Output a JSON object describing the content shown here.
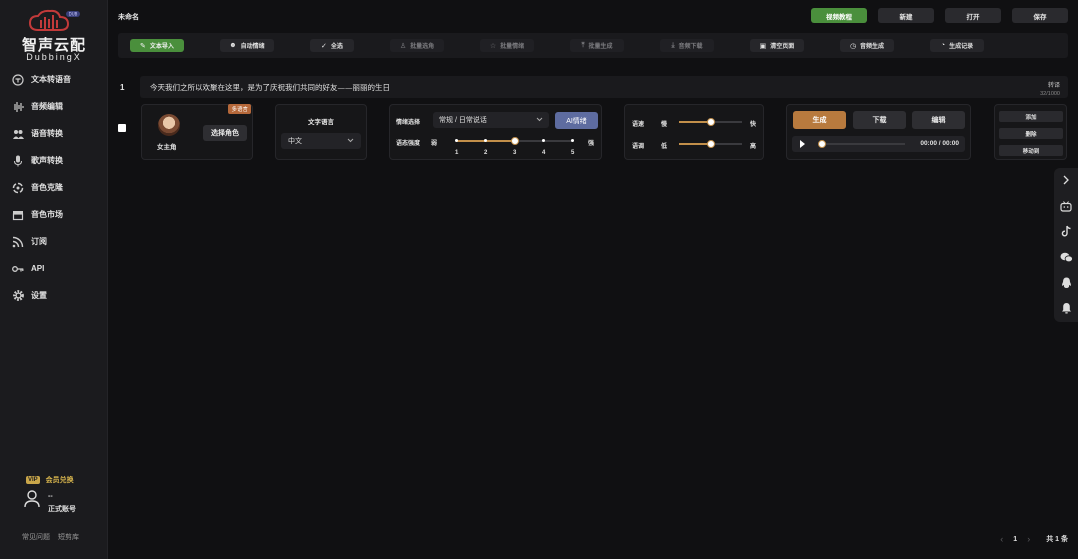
{
  "brand": {
    "name": "智声云配",
    "sub": "DubbingX",
    "badge": "DUB"
  },
  "nav": [
    {
      "label": "文本转语音",
      "icon": "text-to-speech-icon"
    },
    {
      "label": "音频编辑",
      "icon": "waveform-icon"
    },
    {
      "label": "语音转换",
      "icon": "voice-convert-icon"
    },
    {
      "label": "歌声转换",
      "icon": "microphone-icon"
    },
    {
      "label": "音色克隆",
      "icon": "clone-icon"
    },
    {
      "label": "音色市场",
      "icon": "store-icon"
    },
    {
      "label": "订阅",
      "icon": "rss-icon"
    },
    {
      "label": "API",
      "icon": "key-icon"
    },
    {
      "label": "设置",
      "icon": "gear-icon"
    }
  ],
  "sidebar_bottom": {
    "vip_badge": "VIP",
    "vip_label": "会员兑换",
    "user_name": "--",
    "account_type": "正式账号",
    "faq": "常见问题",
    "shortcuts": "短剪库"
  },
  "header": {
    "project_name": "未命名",
    "buttons": {
      "tutorial": "视频教程",
      "new": "新建",
      "open": "打开",
      "save": "保存"
    }
  },
  "toolbar": [
    {
      "label": "文本导入",
      "icon": "✎",
      "state": "green"
    },
    {
      "label": "自动情绪",
      "icon": "☻",
      "state": "normal"
    },
    {
      "label": "全选",
      "icon": "✓",
      "state": "normal"
    },
    {
      "label": "批量选角",
      "icon": "♙",
      "state": "dim"
    },
    {
      "label": "批量情绪",
      "icon": "☆",
      "state": "dim"
    },
    {
      "label": "批量生成",
      "icon": "⤒",
      "state": "dim"
    },
    {
      "label": "音频下载",
      "icon": "⤓",
      "state": "dim"
    },
    {
      "label": "清空页面",
      "icon": "▣",
      "state": "normal"
    },
    {
      "label": "音频生成",
      "icon": "◷",
      "state": "normal"
    },
    {
      "label": "生成记录",
      "icon": "◔",
      "state": "normal"
    }
  ],
  "row": {
    "index": "1",
    "text": "今天我们之所以欢聚在这里，是为了庆祝我们共同的好友——丽丽的生日",
    "translate": "转译",
    "char_count": "32/1000",
    "role": {
      "multi_badge": "多语言",
      "name": "女主角",
      "pick_button": "选择角色"
    },
    "language": {
      "title": "文字语言",
      "value": "中文"
    },
    "emotion": {
      "select_label": "情绪选择",
      "select_value": "常规 / 日常说话",
      "ai_button": "AI情绪",
      "strength_label": "语态强度",
      "weak": "弱",
      "strong": "强",
      "levels": [
        "1",
        "2",
        "3",
        "4",
        "5"
      ],
      "level_value": 3
    },
    "speed": {
      "speed_label": "语速",
      "slow": "慢",
      "fast": "快",
      "speed_value": 0.5,
      "pitch_label": "语调",
      "low": "低",
      "high": "高",
      "pitch_value": 0.5
    },
    "generate": {
      "generate_button": "生成",
      "download_button": "下载",
      "edit_button": "编辑",
      "time": "00:00 / 00:00",
      "progress": 0
    },
    "ops": {
      "add": "添加",
      "delete": "删除",
      "move": "移动到"
    }
  },
  "rightbar": [
    "chevron-right-icon",
    "bilibili-icon",
    "tiktok-icon",
    "wechat-icon",
    "qq-icon",
    "bell-icon"
  ],
  "pager": {
    "prev": "‹",
    "page": "1",
    "next": "›",
    "total": "共 1 条"
  }
}
